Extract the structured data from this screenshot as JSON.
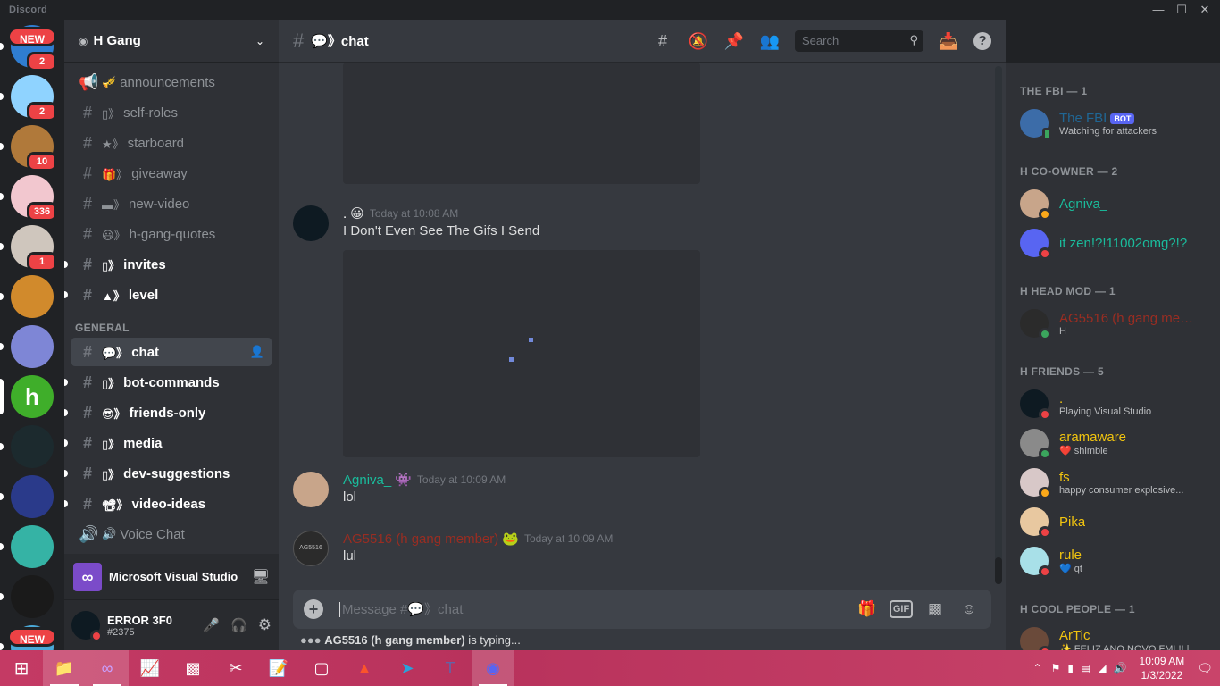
{
  "window": {
    "title": "Discord"
  },
  "rail": {
    "servers": [
      {
        "tag": "NEW",
        "badge": "2",
        "color": "#2f7dd1"
      },
      {
        "badge": "2",
        "color": "#8fd3ff"
      },
      {
        "badge": "10",
        "color": "#b0793a"
      },
      {
        "badge": "336",
        "color": "#f2c7cf"
      },
      {
        "badge": "1",
        "color": "#cfc6bd"
      },
      {
        "badge": "",
        "color": "#d18a2c"
      },
      {
        "badge": "",
        "color": "#7e86d6"
      },
      {
        "badge": "",
        "color": "#3fae2a",
        "letter": "h"
      },
      {
        "badge": "",
        "color": "#1c2a2e"
      },
      {
        "badge": "",
        "color": "#2a3a8a"
      },
      {
        "badge": "",
        "color": "#35b3a5"
      },
      {
        "badge": "",
        "color": "#1a1a1a"
      },
      {
        "tag": "NEW",
        "badge": "",
        "color": "#4aa9d8"
      }
    ]
  },
  "sidebar": {
    "guild_name": "H Gang",
    "channels_top": [
      {
        "icon": "📢",
        "emoji": "🎺",
        "name": "announcements",
        "unread": false
      },
      {
        "icon": "#",
        "emoji": "▯》",
        "name": "self-roles",
        "unread": false
      },
      {
        "icon": "#",
        "emoji": "★》",
        "name": "starboard",
        "unread": false
      },
      {
        "icon": "#",
        "emoji": "🎁》",
        "name": "giveaway",
        "unread": false
      },
      {
        "icon": "#",
        "emoji": "▬》",
        "name": "new-video",
        "unread": false
      },
      {
        "icon": "#",
        "emoji": "😃》",
        "name": "h-gang-quotes",
        "unread": false
      },
      {
        "icon": "#",
        "emoji": "▯》",
        "name": "invites",
        "unread": true
      },
      {
        "icon": "#",
        "emoji": "▲》",
        "name": "level",
        "unread": true
      }
    ],
    "category": "GENERAL",
    "channels_general": [
      {
        "icon": "#",
        "emoji": "💬》",
        "name": "chat",
        "active": true
      },
      {
        "icon": "#",
        "emoji": "▯》",
        "name": "bot-commands",
        "unread": true
      },
      {
        "icon": "#",
        "emoji": "😎》",
        "name": "friends-only",
        "unread": true
      },
      {
        "icon": "#",
        "emoji": "▯》",
        "name": "media",
        "unread": true
      },
      {
        "icon": "#",
        "emoji": "▯》",
        "name": "dev-suggestions",
        "unread": true
      },
      {
        "icon": "#",
        "emoji": "📽》",
        "name": "video-ideas",
        "unread": true
      },
      {
        "icon": "🔊",
        "emoji": "🔊",
        "name": "Voice Chat",
        "unread": false
      }
    ],
    "activity": {
      "label": "Microsoft Visual Studio"
    },
    "user": {
      "name": "ERROR 3F0",
      "tag": "#2375"
    }
  },
  "header": {
    "channel": "💬》chat",
    "search_placeholder": "Search"
  },
  "messages": [
    {
      "author": ".",
      "author_color": "#ffffff",
      "time": "Today at 10:08 AM",
      "text": "I Don't Even See The Gifs I Send",
      "avatar_color": "#0e1a22"
    },
    {
      "author": "Agniva_",
      "author_color": "#1abc9c",
      "time": "Today at 10:09 AM",
      "text": "lol",
      "avatar_color": "#c8a58a"
    },
    {
      "author": "AG5516 (h gang member)",
      "author_color": "#992d22",
      "time": "Today at 10:09 AM",
      "text": "lul",
      "avatar_color": "#2b2b2b",
      "avatar_text": "AG5516"
    }
  ],
  "composer": {
    "placeholder": "Message #💬》chat",
    "gif": "GIF"
  },
  "typing": {
    "user": "AG5516 (h gang member)",
    "suffix": " is typing..."
  },
  "members": {
    "groups": [
      {
        "title": "THE FBI — 1",
        "members": [
          {
            "name": "The FBI",
            "color": "#206694",
            "status": "Watching for attackers",
            "bot": "BOT",
            "avatar_color": "#3c6ca8",
            "state": "mobile"
          }
        ]
      },
      {
        "title": "H CO-OWNER — 2",
        "members": [
          {
            "name": "Agniva_",
            "color": "#1abc9c",
            "status": "",
            "avatar_color": "#c8a58a",
            "state": "idle"
          },
          {
            "name": "it zen!?!11002omg?!?",
            "color": "#1abc9c",
            "status": "",
            "avatar_color": "#5865f2",
            "state": "dnd"
          }
        ]
      },
      {
        "title": "H HEAD MOD — 1",
        "members": [
          {
            "name": "AG5516 (h gang mem...",
            "color": "#992d22",
            "status": "H",
            "avatar_color": "#2b2b2b",
            "state": "online"
          }
        ]
      },
      {
        "title": "H FRIENDS — 5",
        "members": [
          {
            "name": ".",
            "color": "#f1c40f",
            "status": "Playing Visual Studio",
            "avatar_color": "#0e1a22",
            "state": "dnd"
          },
          {
            "name": "aramaware",
            "color": "#f1c40f",
            "status": "❤️ shimble",
            "avatar_color": "#8a8a8a",
            "state": "online"
          },
          {
            "name": "fs",
            "color": "#f1c40f",
            "status": "happy consumer explosive...",
            "avatar_color": "#d8c8c8",
            "state": "idle"
          },
          {
            "name": "Pika",
            "color": "#f1c40f",
            "status": "",
            "avatar_color": "#e8c8a0",
            "state": "dnd"
          },
          {
            "name": "rule",
            "color": "#f1c40f",
            "status": "💙 qt",
            "avatar_color": "#a8e0e8",
            "state": "dnd"
          }
        ]
      },
      {
        "title": "H COOL PEOPLE — 1",
        "members": [
          {
            "name": "ArTic",
            "color": "#f1c40f",
            "status": "✨ FELIZ ANO NOVO FML!! |...",
            "avatar_color": "#6a4a3a",
            "state": "dnd"
          }
        ]
      }
    ]
  },
  "taskbar": {
    "time": "10:09 AM",
    "date": "1/3/2022"
  }
}
